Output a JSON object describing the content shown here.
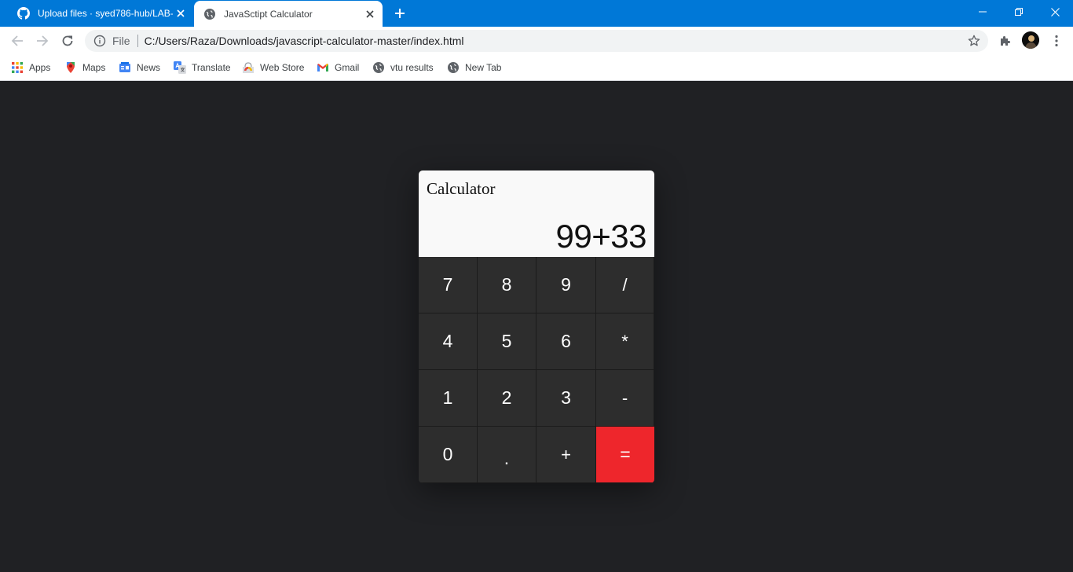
{
  "browser": {
    "tabs": [
      {
        "title": "Upload files · syed786-hub/LAB-p",
        "active": false,
        "favicon": "github-icon"
      },
      {
        "title": "JavaSctipt Calculator",
        "active": true,
        "favicon": "globe-icon"
      }
    ],
    "omnibox": {
      "scheme_label": "File",
      "url": "C:/Users/Raza/Downloads/javascript-calculator-master/index.html"
    },
    "bookmarks": [
      {
        "label": "Apps",
        "icon": "apps-grid-icon"
      },
      {
        "label": "Maps",
        "icon": "maps-icon"
      },
      {
        "label": "News",
        "icon": "news-icon"
      },
      {
        "label": "Translate",
        "icon": "translate-icon"
      },
      {
        "label": "Web Store",
        "icon": "web-store-icon"
      },
      {
        "label": "Gmail",
        "icon": "gmail-icon"
      },
      {
        "label": "vtu results",
        "icon": "globe-icon"
      },
      {
        "label": "New Tab",
        "icon": "globe-icon"
      }
    ],
    "colors": {
      "titlebar": "#0078d7",
      "page_bg": "#202124"
    }
  },
  "calculator": {
    "title": "Calculator",
    "display": "99+33",
    "keys": [
      "7",
      "8",
      "9",
      "/",
      "4",
      "5",
      "6",
      "*",
      "1",
      "2",
      "3",
      "-",
      "0",
      ".",
      "+",
      "="
    ],
    "colors": {
      "key_bg": "#2d2d2d",
      "equals_bg": "#ee262c",
      "display_bg": "#f9f9f9"
    }
  }
}
